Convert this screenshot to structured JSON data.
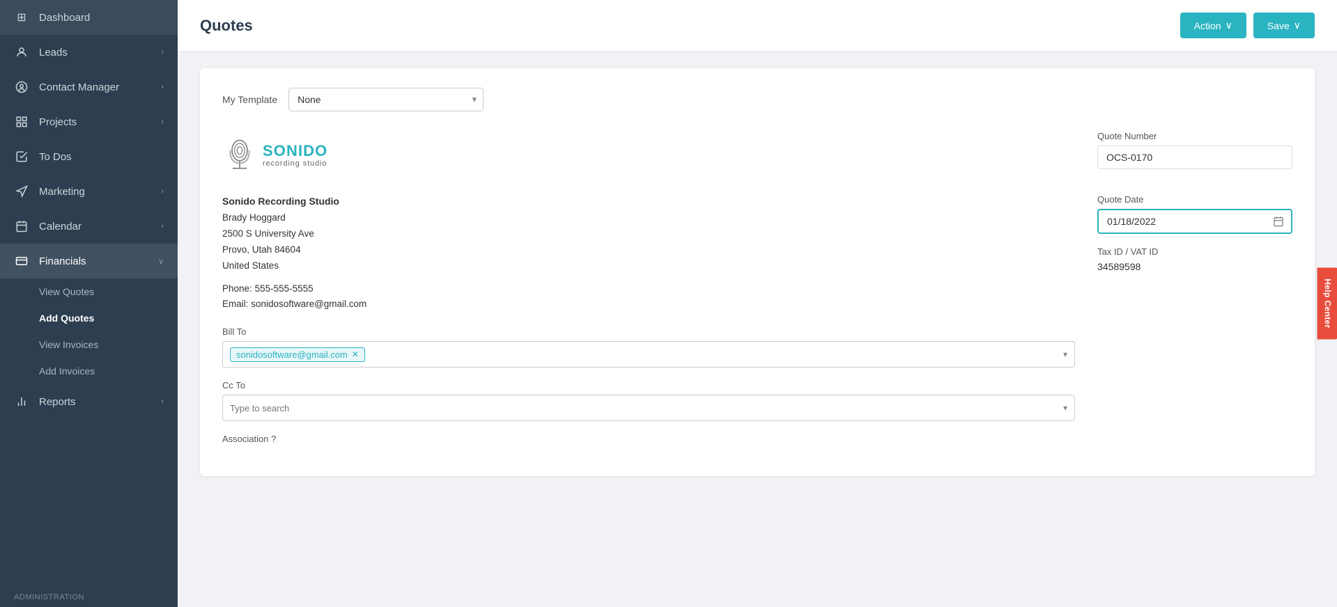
{
  "sidebar": {
    "items": [
      {
        "id": "dashboard",
        "label": "Dashboard",
        "icon": "⊞",
        "hasChevron": false
      },
      {
        "id": "leads",
        "label": "Leads",
        "icon": "◎",
        "hasChevron": true
      },
      {
        "id": "contact-manager",
        "label": "Contact Manager",
        "icon": "◉",
        "hasChevron": true
      },
      {
        "id": "projects",
        "label": "Projects",
        "icon": "☰",
        "hasChevron": true
      },
      {
        "id": "todos",
        "label": "To Dos",
        "icon": "☑",
        "hasChevron": false
      },
      {
        "id": "marketing",
        "label": "Marketing",
        "icon": "📣",
        "hasChevron": true
      },
      {
        "id": "calendar",
        "label": "Calendar",
        "icon": "📅",
        "hasChevron": true
      },
      {
        "id": "financials",
        "label": "Financials",
        "icon": "💳",
        "hasChevron": true,
        "expanded": true
      }
    ],
    "financials_sub": [
      {
        "id": "view-quotes",
        "label": "View Quotes"
      },
      {
        "id": "add-quotes",
        "label": "Add Quotes",
        "active": true
      },
      {
        "id": "view-invoices",
        "label": "View Invoices"
      },
      {
        "id": "add-invoices",
        "label": "Add Invoices"
      }
    ],
    "bottom_items": [
      {
        "id": "reports",
        "label": "Reports",
        "icon": "📊",
        "hasChevron": true
      },
      {
        "id": "administration",
        "label": "Administration",
        "icon": "",
        "isSection": true
      }
    ]
  },
  "page": {
    "title": "Quotes",
    "action_btn": "Action",
    "save_btn": "Save"
  },
  "form": {
    "template_label": "My Template",
    "template_value": "None",
    "company": {
      "name": "Sonido Recording Studio",
      "contact": "Brady Hoggard",
      "address1": "2500 S University Ave",
      "address2": "Provo, Utah 84604",
      "country": "United States",
      "phone_label": "Phone:",
      "phone": "555-555-5555",
      "email_label": "Email:",
      "email": "sonidosoftware@gmail.com"
    },
    "bill_to_label": "Bill To",
    "bill_to_tag": "sonidosoftware@gmail.com",
    "cc_to_label": "Cc To",
    "cc_to_placeholder": "Type to search",
    "association_label": "Association ?",
    "quote_number_label": "Quote Number",
    "quote_number_value": "OCS-0170",
    "quote_date_label": "Quote Date",
    "quote_date_value": "01/18/2022",
    "tax_id_label": "Tax ID / VAT ID",
    "tax_id_value": "34589598"
  },
  "help_center": {
    "label": "Help Center"
  }
}
